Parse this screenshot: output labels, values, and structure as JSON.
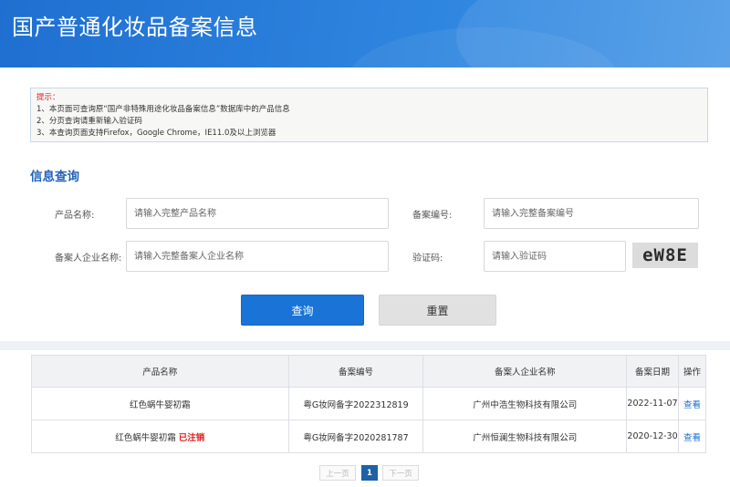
{
  "header": {
    "title": "国产普通化妆品备案信息"
  },
  "tips": {
    "title": "提示：",
    "lines": [
      "1、本页面可查询原“国产非特殊用途化妆品备案信息”数据库中的产品信息",
      "2、分页查询请重新输入验证码",
      "3、本查询页面支持Firefox，Google Chrome，IE11.0及以上浏览器"
    ]
  },
  "search": {
    "section_title": "信息查询",
    "product_name": {
      "label": "产品名称:",
      "placeholder": "请输入完整产品名称"
    },
    "record_no": {
      "label": "备案编号:",
      "placeholder": "请输入完整备案编号"
    },
    "company": {
      "label": "备案人企业名称:",
      "placeholder": "请输入完整备案人企业名称"
    },
    "captcha": {
      "label": "验证码:",
      "placeholder": "请输入验证码",
      "image_text": "eW8E"
    },
    "query_button": "查询",
    "reset_button": "重置"
  },
  "table": {
    "headers": [
      "产品名称",
      "备案编号",
      "备案人企业名称",
      "备案日期",
      "操作"
    ],
    "rows": [
      {
        "name": "红色蜗牛婴初霜",
        "status": "",
        "record_no": "粤G妆网备字2022312819",
        "company": "广州中浩生物科技有限公司",
        "date": "2022-11-07",
        "action": "查看"
      },
      {
        "name": "红色蜗牛婴初霜",
        "status": "已注销",
        "record_no": "粤G妆网备字2020281787",
        "company": "广州恒澜生物科技有限公司",
        "date": "2020-12-30",
        "action": "查看"
      }
    ]
  },
  "pager": {
    "prev": "上一页",
    "current": "1",
    "next": "下一页"
  }
}
